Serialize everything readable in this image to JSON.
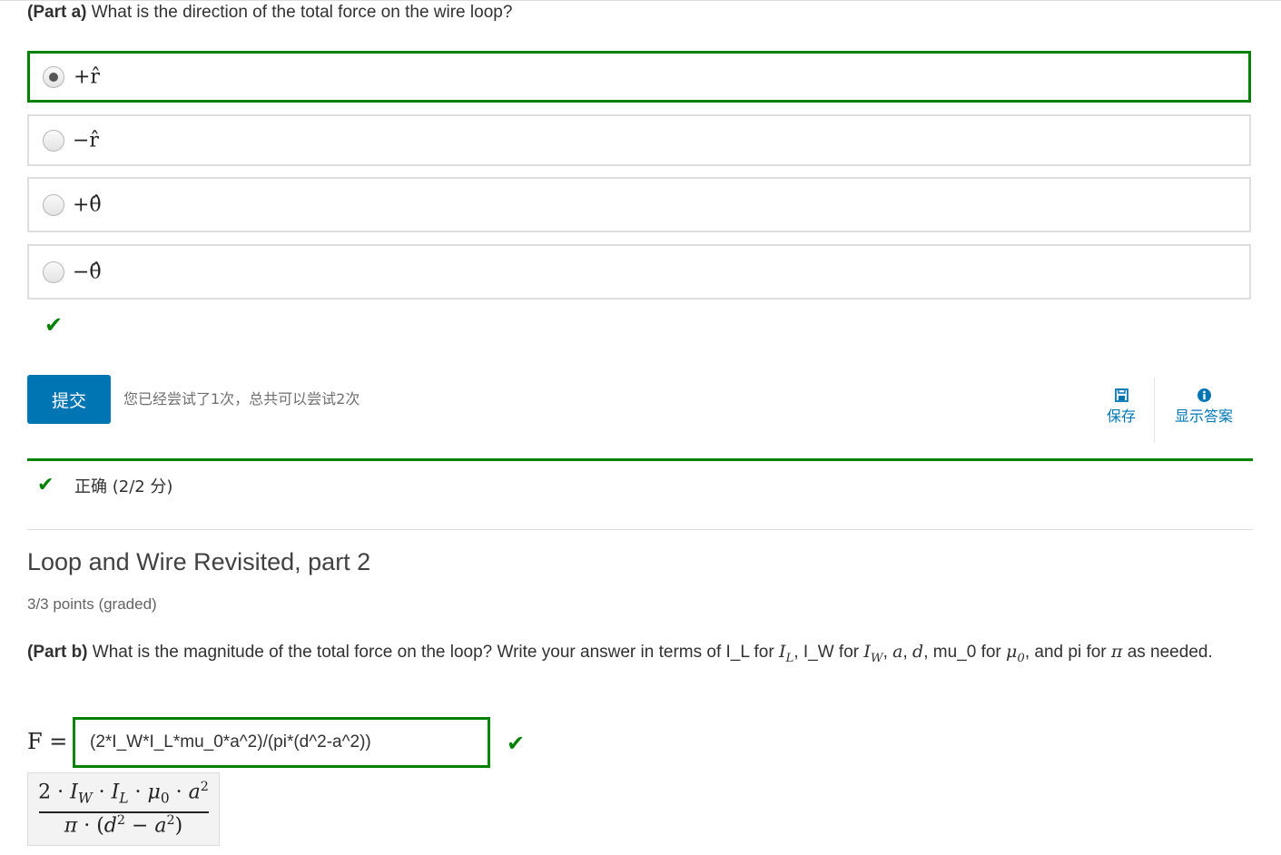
{
  "question_a": {
    "prefix": "(Part a)",
    "text": " What is the direction of the total force on the wire loop?",
    "options": [
      {
        "label": "+r̂",
        "selected": true
      },
      {
        "label": "−r̂",
        "selected": false
      },
      {
        "label": "+θ̂",
        "selected": false
      },
      {
        "label": "−θ̂",
        "selected": false
      }
    ]
  },
  "submit": {
    "label": "提交",
    "attempts_text": "您已经尝试了1次，总共可以尝试2次"
  },
  "actions": {
    "save_label": "保存",
    "show_answer_label": "显示答案"
  },
  "status": {
    "text": "正确 (2/2 分)"
  },
  "section": {
    "title": "Loop and Wire Revisited, part 2",
    "points": "3/3 points (graded)"
  },
  "question_b": {
    "prefix": "(Part b)",
    "t1": " What is the magnitude of the total force on the loop? Write your answer in terms of I_L for ",
    "v_il": "I",
    "v_il_sub": "L",
    "t2": ", I_W for ",
    "v_iw": "I",
    "v_iw_sub": "W",
    "t3": ", ",
    "v_a": "a",
    "t4": ", ",
    "v_d": "d",
    "t5": ", mu_0 for ",
    "v_mu": "μ",
    "v_mu_sub": "0",
    "t6": ", and pi for ",
    "v_pi": "π",
    "t7": " as needed."
  },
  "answer": {
    "label": "F =",
    "value": "(2*I_W*I_L*mu_0*a^2)/(pi*(d^2-a^2))",
    "preview_numerator": "2 · I_W · I_L · μ_0 · a²",
    "preview_denominator": "π · (d² − a²)"
  },
  "colors": {
    "correct": "#008100",
    "primary": "#0075b4"
  }
}
